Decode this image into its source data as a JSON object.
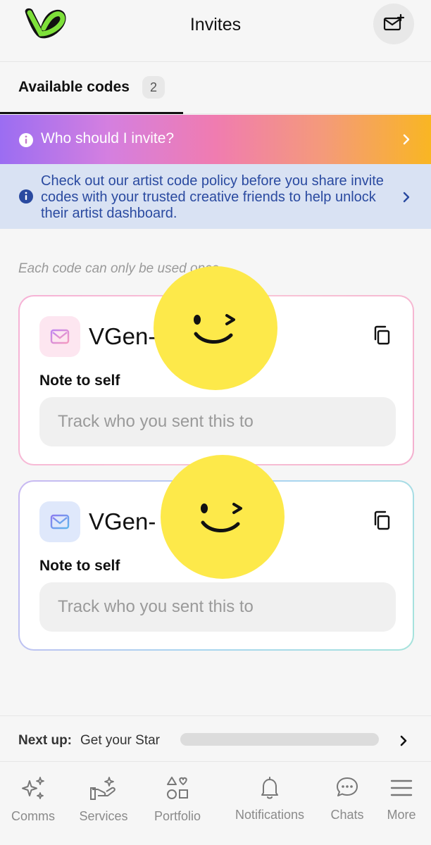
{
  "header": {
    "title": "Invites"
  },
  "tabs": [
    {
      "label": "Available codes",
      "count": "2"
    }
  ],
  "banners": {
    "who_to_invite": "Who should I invite?",
    "policy": "Check out our artist code policy before you share invite codes with your trusted creative friends to help unlock their artist dashboard."
  },
  "hint": "Each code can only be used once",
  "codes": [
    {
      "code": "VGen-",
      "note_label": "Note to self",
      "note_placeholder": "Track who you sent this to",
      "note_value": ""
    },
    {
      "code": "VGen-",
      "note_label": "Note to self",
      "note_placeholder": "Track who you sent this to",
      "note_value": ""
    }
  ],
  "next_up": {
    "label": "Next up:",
    "value": "Get your Star",
    "progress": 0
  },
  "nav": [
    {
      "label": "Comms",
      "icon": "sparkles-icon"
    },
    {
      "label": "Services",
      "icon": "hand-star-icon"
    },
    {
      "label": "Portfolio",
      "icon": "shapes-icon"
    },
    {
      "label": "Notifications",
      "icon": "bell-icon"
    },
    {
      "label": "Chats",
      "icon": "chat-bubble-icon"
    },
    {
      "label": "More",
      "icon": "menu-icon"
    }
  ],
  "colors": {
    "brand_green": "#7ee03a",
    "sticker_yellow": "#fde94a",
    "policy_text": "#2a4aa0",
    "policy_bg": "#d9e2f3"
  }
}
